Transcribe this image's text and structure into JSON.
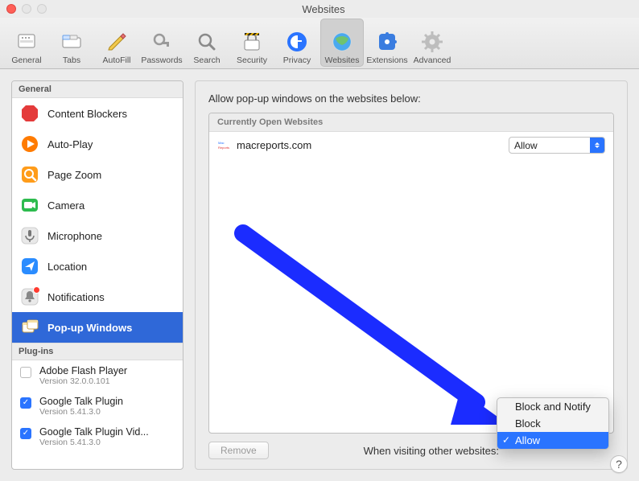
{
  "window": {
    "title": "Websites"
  },
  "toolbar": {
    "items": [
      {
        "id": "general",
        "label": "General"
      },
      {
        "id": "tabs",
        "label": "Tabs"
      },
      {
        "id": "autofill",
        "label": "AutoFill"
      },
      {
        "id": "passwords",
        "label": "Passwords"
      },
      {
        "id": "search",
        "label": "Search"
      },
      {
        "id": "security",
        "label": "Security"
      },
      {
        "id": "privacy",
        "label": "Privacy"
      },
      {
        "id": "websites",
        "label": "Websites",
        "selected": true
      },
      {
        "id": "extensions",
        "label": "Extensions"
      },
      {
        "id": "advanced",
        "label": "Advanced"
      }
    ]
  },
  "sidebar": {
    "general_header": "General",
    "plugins_header": "Plug-ins",
    "items": [
      {
        "id": "content-blockers",
        "label": "Content Blockers"
      },
      {
        "id": "auto-play",
        "label": "Auto-Play"
      },
      {
        "id": "page-zoom",
        "label": "Page Zoom"
      },
      {
        "id": "camera",
        "label": "Camera"
      },
      {
        "id": "microphone",
        "label": "Microphone"
      },
      {
        "id": "location",
        "label": "Location"
      },
      {
        "id": "notifications",
        "label": "Notifications",
        "badge": true
      },
      {
        "id": "popup-windows",
        "label": "Pop-up Windows",
        "selected": true
      }
    ],
    "plugins": [
      {
        "name": "Adobe Flash Player",
        "version": "Version 32.0.0.101",
        "enabled": false
      },
      {
        "name": "Google Talk Plugin",
        "version": "Version 5.41.3.0",
        "enabled": true
      },
      {
        "name": "Google Talk Plugin Vid...",
        "version": "Version 5.41.3.0",
        "enabled": true
      }
    ]
  },
  "right": {
    "heading": "Allow pop-up windows on the websites below:",
    "list_header": "Currently Open Websites",
    "rows": [
      {
        "host": "macreports.com",
        "setting": "Allow"
      }
    ],
    "remove_label": "Remove",
    "bottom_label": "When visiting other websites:",
    "dropdown": {
      "options": [
        "Block and Notify",
        "Block",
        "Allow"
      ],
      "selected": "Allow"
    }
  },
  "help_label": "?"
}
